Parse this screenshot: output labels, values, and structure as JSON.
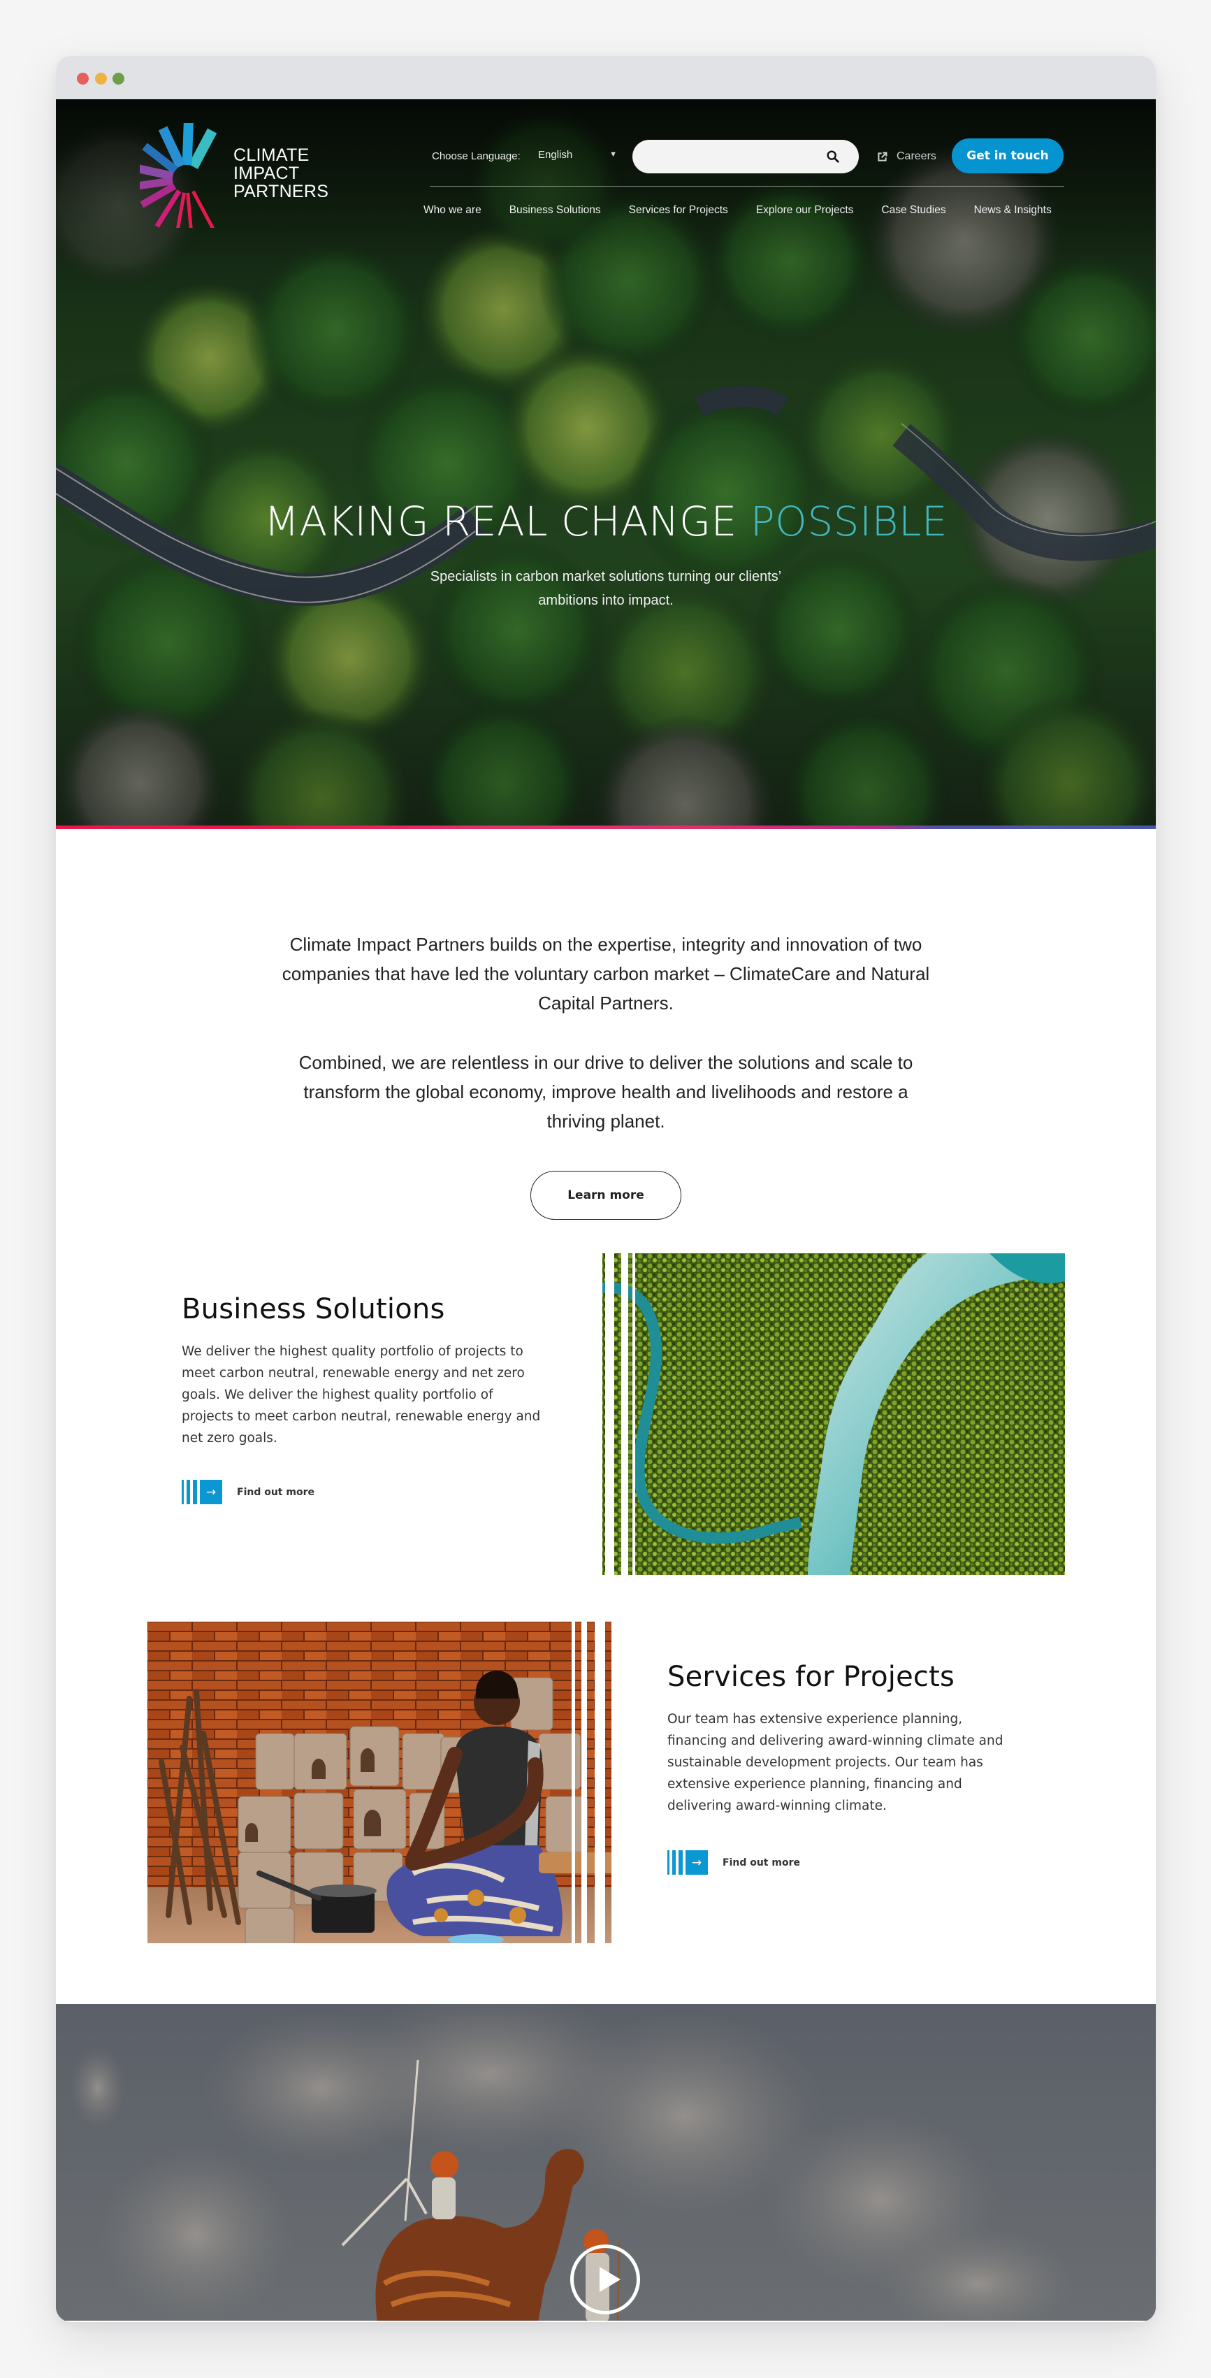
{
  "window": {
    "controls": [
      "close",
      "minimize",
      "maximize"
    ]
  },
  "brand": {
    "logo_lines": [
      "CLIMATE",
      "IMPACT",
      "PARTNERS"
    ],
    "logo_icon": "sunburst-logo-icon"
  },
  "header": {
    "language_label": "Choose Language:",
    "language_value": "English",
    "search_placeholder": "",
    "search_icon": "search-icon",
    "careers_label": "Careers",
    "careers_icon": "external-link-icon",
    "cta_label": "Get in touch"
  },
  "nav": {
    "items": [
      {
        "label": "Who we are"
      },
      {
        "label": "Business Solutions"
      },
      {
        "label": "Services for Projects"
      },
      {
        "label": "Explore our Projects"
      },
      {
        "label": "Case Studies"
      },
      {
        "label": "News & Insights"
      }
    ]
  },
  "hero": {
    "title_main": "MAKING REAL CHANGE ",
    "title_accent": "POSSIBLE",
    "subtitle_line1": "Specialists in carbon market solutions turning our clients’",
    "subtitle_line2": "ambitions into impact."
  },
  "intro": {
    "paragraph1": "Climate Impact Partners builds on the expertise, integrity and innovation of two companies that have led the voluntary carbon market – ClimateCare and Natural Capital Partners.",
    "paragraph2": "Combined, we are relentless in our drive to deliver the solutions and scale to transform the global economy, improve health and livelihoods and restore a thriving planet.",
    "button_label": "Learn more"
  },
  "features": [
    {
      "title": "Business Solutions",
      "body": "We deliver the highest quality portfolio of projects to meet carbon neutral, renewable energy and net zero goals. We deliver the highest quality portfolio of projects to meet carbon neutral, renewable energy and net zero goals.",
      "link_label": "Find out more",
      "link_icon": "arrow-right-icon",
      "image": "aerial-river-forest-image"
    },
    {
      "title": "Services for Projects",
      "body": "Our team has extensive experience planning, financing and delivering award-winning climate and sustainable development projects. Our team has extensive experience planning, financing and delivering award-winning climate.",
      "link_label": "Find out more",
      "link_icon": "arrow-right-icon",
      "image": "woman-cookstove-image"
    }
  ],
  "video": {
    "image": "camel-wind-turbine-image",
    "play_icon": "play-icon"
  },
  "colors": {
    "accent_teal": "#44b8c0",
    "primary_blue": "#0594cf",
    "stripe_pink": "#e8194a",
    "stripe_purple": "#b32b8b",
    "stripe_indigo": "#4a57a8"
  }
}
